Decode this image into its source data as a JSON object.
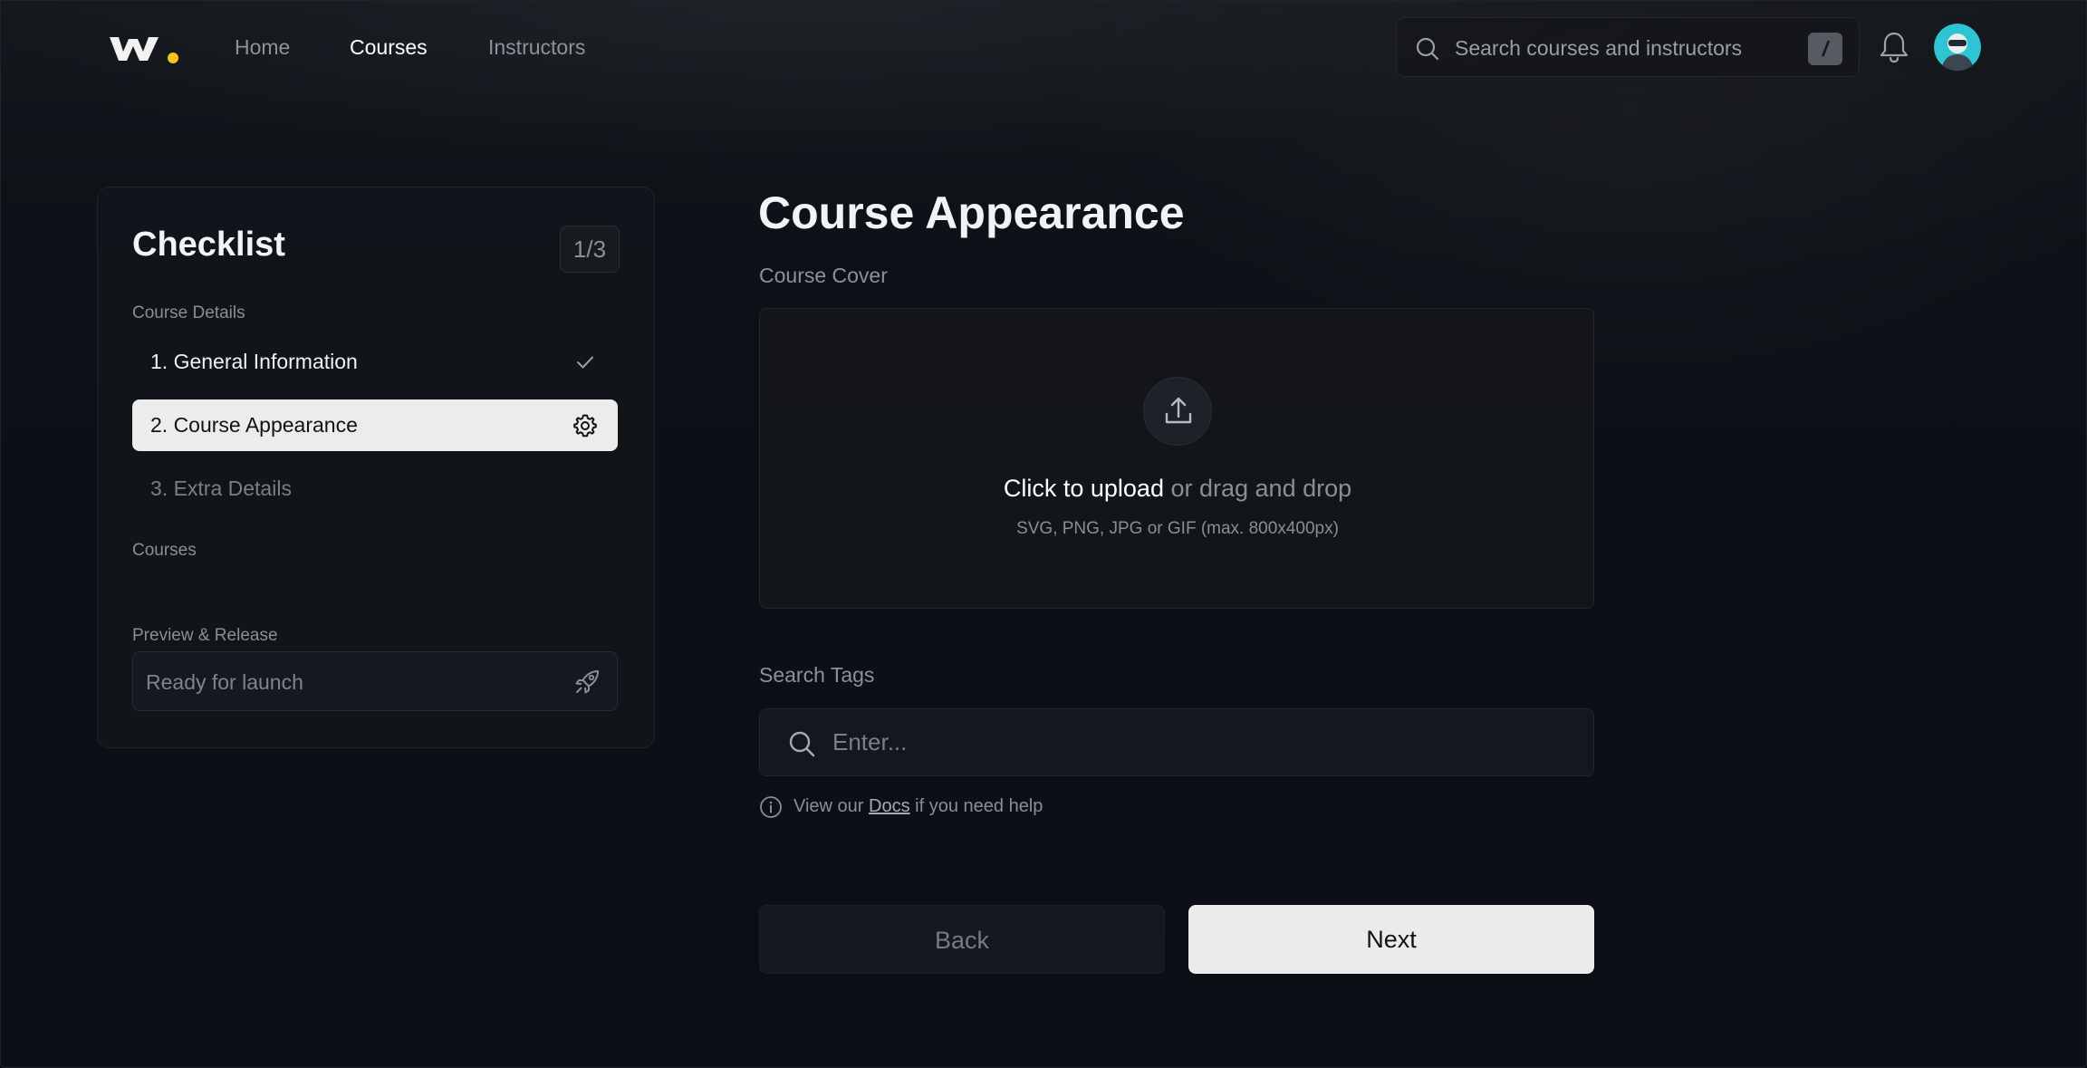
{
  "nav": {
    "links": [
      {
        "label": "Home",
        "active": false
      },
      {
        "label": "Courses",
        "active": true
      },
      {
        "label": "Instructors",
        "active": false
      }
    ],
    "search_placeholder": "Search courses and instructors",
    "search_shortcut": "/"
  },
  "checklist": {
    "title": "Checklist",
    "progress": "1/3",
    "sections": {
      "course_details": "Course Details",
      "courses": "Courses",
      "preview_release": "Preview & Release"
    },
    "steps": [
      {
        "label": "1. General Information",
        "state": "done",
        "icon": "check-icon"
      },
      {
        "label": "2. Course Appearance",
        "state": "active",
        "icon": "gear-icon"
      },
      {
        "label": "3. Extra Details",
        "state": "pending",
        "icon": ""
      }
    ],
    "launch_label": "Ready for launch",
    "launch_icon": "rocket-icon"
  },
  "main": {
    "title": "Course Appearance",
    "cover_label": "Course Cover",
    "upload": {
      "primary": "Click to upload",
      "secondary": "or drag and drop",
      "hint": "SVG, PNG, JPG or GIF (max. 800x400px)"
    },
    "tags_label": "Search Tags",
    "tags_placeholder": "Enter...",
    "help": {
      "prefix": "View our",
      "link": "Docs",
      "suffix": "if you need help"
    },
    "back_label": "Back",
    "next_label": "Next"
  },
  "colors": {
    "background": "#0b0f15",
    "active_step_bg": "#ececed",
    "next_button_bg": "#ebebec",
    "logo_accent": "#f5c518",
    "avatar_bg": "#2ec4d4"
  }
}
